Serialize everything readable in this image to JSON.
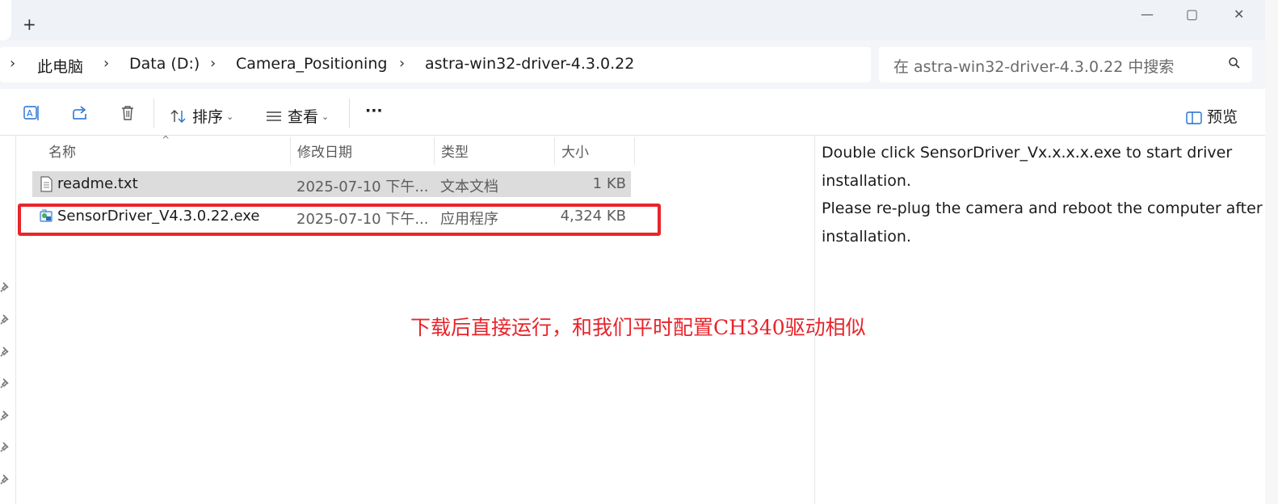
{
  "window": {
    "new_tab_symbol": "+",
    "minimize_symbol": "—",
    "maximize_symbol": "▢",
    "close_symbol": "✕"
  },
  "address": {
    "crumbs": [
      "此电脑",
      "Data (D:)",
      "Camera_Positioning",
      "astra-win32-driver-4.3.0.22"
    ],
    "chevron": "›"
  },
  "search": {
    "placeholder": "在 astra-win32-driver-4.3.0.22 中搜索"
  },
  "toolbar": {
    "sort_label": "排序",
    "view_label": "查看",
    "more_label": "···",
    "preview_label": "预览",
    "icons": [
      "rename-icon",
      "share-icon",
      "delete-icon",
      "sort-icon",
      "view-icon",
      "more-icon",
      "preview-pane-icon"
    ]
  },
  "columns": {
    "name": "名称",
    "date": "修改日期",
    "type": "类型",
    "size": "大小"
  },
  "files": [
    {
      "name": "readme.txt",
      "date": "2025-07-10 下午...",
      "type": "文本文档",
      "size": "1 KB",
      "selected": true,
      "icon": "text-file-icon"
    },
    {
      "name": "SensorDriver_V4.3.0.22.exe",
      "date": "2025-07-10 下午...",
      "type": "应用程序",
      "size": "4,324 KB",
      "selected": false,
      "icon": "installer-exe-icon"
    }
  ],
  "annotation": {
    "text": "下载后直接运行，和我们平时配置CH340驱动相似",
    "color": "#e8242b"
  },
  "preview": {
    "text": "Double click SensorDriver_Vx.x.x.x.exe to start driver\ninstallation.\nPlease re-plug the camera and reboot the computer after the\ninstallation."
  },
  "colors": {
    "accent_red": "#e8242b",
    "selected_row": "#dcdcdc",
    "titlebar": "#eff2f6"
  }
}
